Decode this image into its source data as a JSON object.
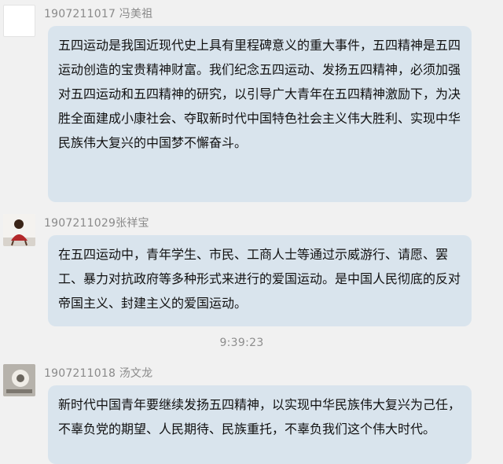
{
  "messages": [
    {
      "sender": "1907211017  冯美祖",
      "text": "五四运动是我国近现代史上具有里程碑意义的重大事件，五四精神是五四运动创造的宝贵精神财富。我们纪念五四运动、发扬五四精神，必须加强对五四运动和五四精神的研究，以引导广大青年在五四精神激励下，为决胜全面建成小康社会、夺取新时代中国特色社会主义伟大胜利、实现中华民族伟大复兴的中国梦不懈奋斗。"
    },
    {
      "sender": "1907211029张祥宝",
      "text": "在五四运动中，青年学生、市民、工商人士等通过示威游行、请愿、罢工、暴力对抗政府等多种形式来进行的爱国运动。是中国人民彻底的反对帝国主义、封建主义的爱国运动。"
    },
    {
      "sender": "1907211018 汤文龙",
      "text": "新时代中国青年要继续发扬五四精神，以实现中华民族伟大复兴为己任，不辜负党的期望、人民期待、民族重托，不辜负我们这个伟大时代。"
    }
  ],
  "timestamp": "9:39:23"
}
